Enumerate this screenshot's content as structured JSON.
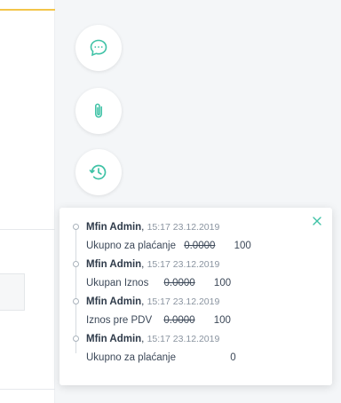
{
  "sidebar": {
    "buttons": [
      {
        "name": "comments",
        "icon": "chat-bubble-icon"
      },
      {
        "name": "attachments",
        "icon": "paperclip-icon"
      },
      {
        "name": "history",
        "icon": "history-clock-icon"
      }
    ]
  },
  "history_popover": {
    "close_icon": "close-icon",
    "entries": [
      {
        "author": "Mfin Admin",
        "sep": ",",
        "time": "15:17 23.12.2019",
        "field": "Ukupno za plaćanje",
        "old_value": "0.0000",
        "new_value": "100"
      },
      {
        "author": "Mfin Admin",
        "sep": ",",
        "time": "15:17 23.12.2019",
        "field": "Ukupan Iznos",
        "old_value": "0.0000",
        "new_value": "100"
      },
      {
        "author": "Mfin Admin",
        "sep": ",",
        "time": "15:17 23.12.2019",
        "field": "Iznos pre PDV",
        "old_value": "0.0000",
        "new_value": "100"
      },
      {
        "author": "Mfin Admin",
        "sep": ",",
        "time": "15:17 23.12.2019",
        "field": "Ukupno za plaćanje",
        "old_value": "",
        "new_value": "0"
      }
    ]
  },
  "colors": {
    "accent": "#3fc2a6",
    "panel_bg": "#f4f6f8",
    "top_accent": "#f3c54a"
  }
}
